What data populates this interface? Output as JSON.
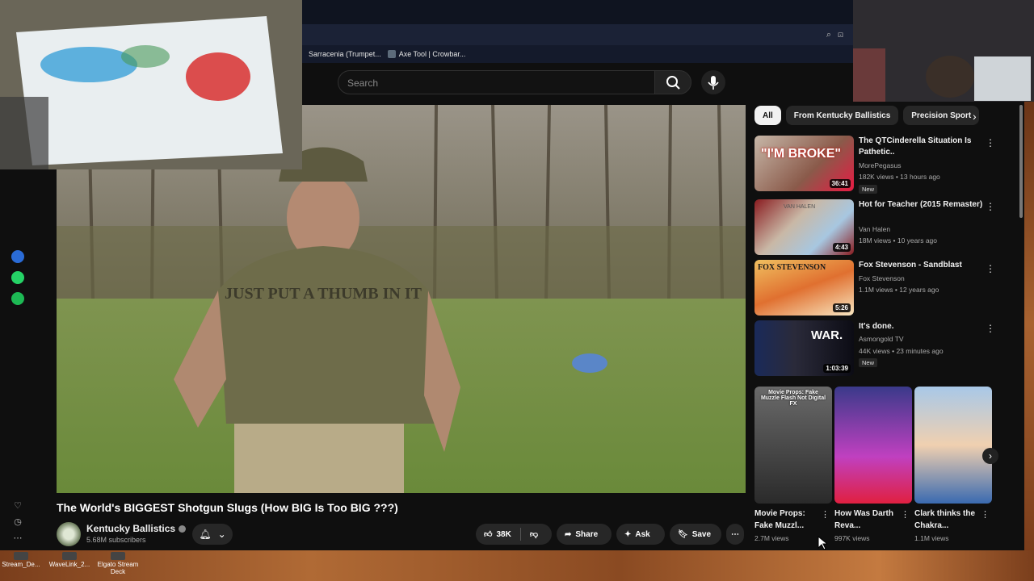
{
  "bookmarks": [
    {
      "label": "Sarracenia (Trumpet..."
    },
    {
      "label": "Axe Tool | Crowbar..."
    }
  ],
  "search": {
    "placeholder": "Search"
  },
  "video": {
    "title": "The World's BIGGEST Shotgun Slugs (How BIG Is Too BIG ???)",
    "channel": "Kentucky Ballistics",
    "subscribers": "5.68M subscribers",
    "shirt_text": "JUST PUT A THUMB IN IT",
    "likes": "38K",
    "share_label": "Share",
    "ask_label": "Ask",
    "save_label": "Save"
  },
  "chips": [
    "All",
    "From Kentucky Ballistics",
    "Precision Sport"
  ],
  "recommendations": [
    {
      "title": "The QTCinderella Situation Is Pathetic..",
      "channel": "MorePegasus",
      "meta": "182K views • 13 hours ago",
      "duration": "36:41",
      "badge": "New",
      "thumb_text": "\"I'M BROKE\""
    },
    {
      "title": "Hot for Teacher (2015 Remaster)",
      "channel": "Van Halen",
      "meta": "18M views • 10 years ago",
      "duration": "4:43",
      "badge": "",
      "thumb_text": "VAN HALEN"
    },
    {
      "title": "Fox Stevenson - Sandblast",
      "channel": "Fox Stevenson",
      "meta": "1.1M views • 12 years ago",
      "duration": "5:26",
      "badge": "",
      "thumb_text": "FOX STEVENSON"
    },
    {
      "title": "It's done.",
      "channel": "Asmongold TV",
      "meta": "44K views • 23 minutes ago",
      "duration": "1:03:39",
      "badge": "New",
      "thumb_text": "WAR."
    }
  ],
  "shorts": [
    {
      "title": "Movie Props: Fake Muzzl...",
      "views": "2.7M views",
      "overlay": "Movie Props: Fake Muzzle Flash Not Digital FX"
    },
    {
      "title": "How Was Darth Reva...",
      "views": "997K views",
      "overlay": ""
    },
    {
      "title": "Clark thinks the Chakra...",
      "views": "1.1M views",
      "overlay": ""
    }
  ],
  "desktop_icons": [
    "Stream_De...",
    "WaveLink_2...",
    "Elgato Stream Deck"
  ],
  "colors": {
    "accent": "#ff0000",
    "background": "#0f0f0f",
    "chip_bg": "#272727"
  }
}
